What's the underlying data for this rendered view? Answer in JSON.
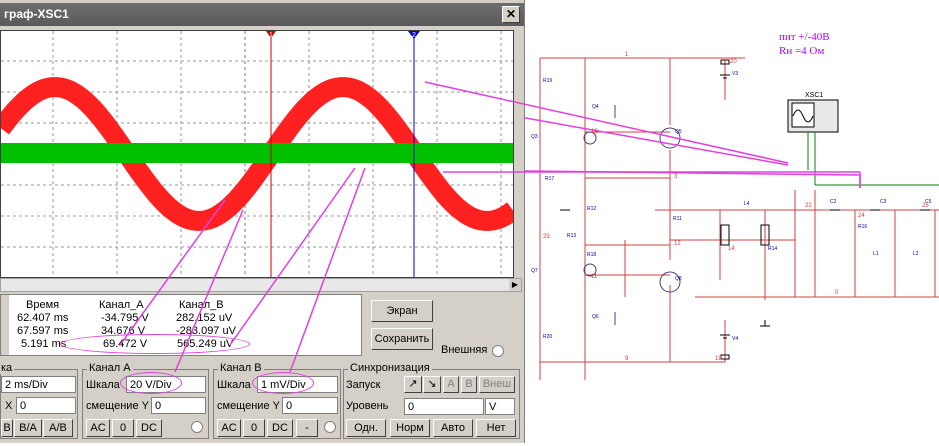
{
  "window": {
    "title": "граф-XSC1",
    "close_label": "✕"
  },
  "readout": {
    "headers": [
      "Время",
      "Канал_А",
      "Канал_В"
    ],
    "rows": [
      [
        "62.407 ms",
        "-34.795 V",
        "282.152 uV"
      ],
      [
        "67.597 ms",
        "34.676 V",
        "-283.097 uV"
      ],
      [
        "5.191 ms",
        "69.472 V",
        "565.249 uV"
      ]
    ]
  },
  "buttons": {
    "screen": "Экран",
    "save": "Сохранить",
    "external": "Внешняя"
  },
  "timebase": {
    "partial_label": "ка",
    "scale_value": "2 ms/Div",
    "x_label": "X",
    "x_value": "0",
    "btns": [
      "B",
      "B/A",
      "A/B"
    ]
  },
  "channel_a": {
    "title": "Канал А",
    "scale_label": "Шкала",
    "scale_value": "20  V/Div",
    "offset_label": "смещение Y",
    "offset_value": "0",
    "coupling": [
      "AC",
      "0",
      "DC"
    ]
  },
  "channel_b": {
    "title": "Канал В",
    "scale_label": "Шкала",
    "scale_value": "1 mV/Div",
    "offset_label": "смещение Y",
    "offset_value": "0",
    "coupling": [
      "AC",
      "0",
      "DC",
      "-"
    ]
  },
  "sync": {
    "title": "Синхронизация",
    "trigger_label": "Запуск",
    "trigger_btns": [
      "A",
      "B",
      "Внеш"
    ],
    "level_label": "Уровень",
    "level_value": "0",
    "level_unit": "V",
    "modes": [
      "Одн.",
      "Норм",
      "Авто",
      "Нет"
    ]
  },
  "cursors": {
    "c1": "1",
    "c2": "2"
  },
  "schematic": {
    "note_line1": "пит +/-40В",
    "note_line2": "Rн =4 Ом",
    "scope_label": "XSC1",
    "node_labels": [
      "1",
      "20",
      "10",
      "3",
      "22",
      "24",
      "25",
      "14",
      "11",
      "23",
      "12",
      "9",
      "18",
      "0"
    ],
    "part_labels": [
      "R19",
      "R20",
      "Q4",
      "Q5",
      "Q3",
      "R11",
      "R12",
      "Q6",
      "Q7",
      "Q8",
      "C2",
      "C3",
      "C5",
      "L1",
      "L2",
      "R16",
      "R14",
      "L4",
      "V3",
      "V4",
      "R17",
      "R13",
      "R18"
    ]
  },
  "colors": {
    "channel_a": "#ff2020",
    "channel_b": "#00c000",
    "annotation": "#e040e0",
    "cursor1": "#cc0000",
    "cursor2": "#0000cc"
  }
}
